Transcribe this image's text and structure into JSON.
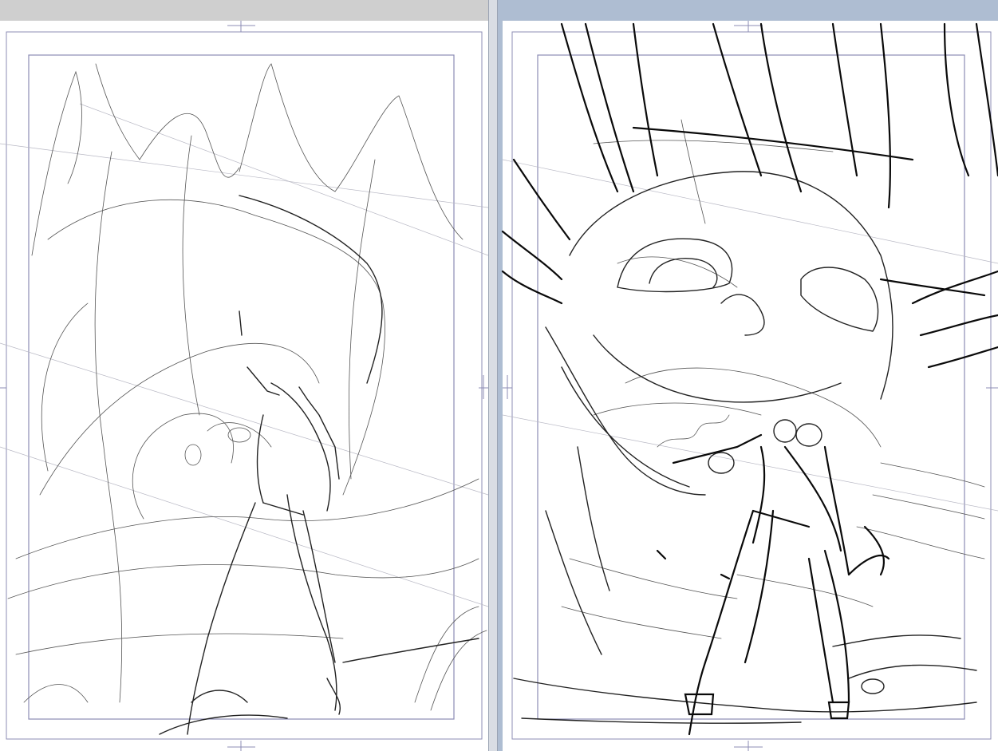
{
  "app": {
    "name": "",
    "colors": {
      "workspace_left": "#cfcfcf",
      "workspace_right": "#aebdd2",
      "page": "#ffffff",
      "frame_line": "#8c8cb4",
      "ink": "#111111"
    }
  },
  "panes": [
    {
      "id": "left",
      "label": "",
      "page": "rough-sketch",
      "active": false
    },
    {
      "id": "right",
      "label": "",
      "page": "refined-sketch",
      "active": true
    }
  ],
  "icons": {
    "register_mark": "crosshair-icon"
  }
}
